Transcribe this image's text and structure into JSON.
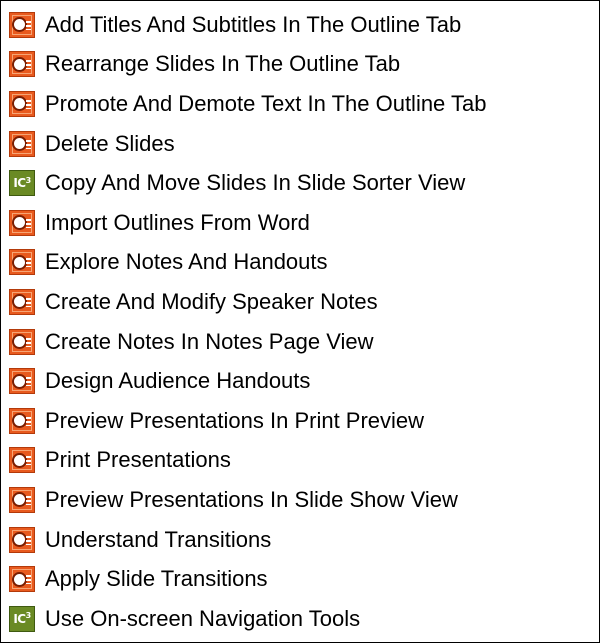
{
  "items": [
    {
      "label": "Add Titles And Subtitles In The Outline Tab",
      "icon": "ppt"
    },
    {
      "label": "Rearrange Slides In The Outline Tab",
      "icon": "ppt"
    },
    {
      "label": "Promote And Demote Text In The Outline Tab",
      "icon": "ppt"
    },
    {
      "label": "Delete Slides",
      "icon": "ppt"
    },
    {
      "label": "Copy And Move Slides In Slide Sorter View",
      "icon": "ic3",
      "badge": "IC",
      "badge_sup": "3"
    },
    {
      "label": "Import Outlines From Word",
      "icon": "ppt"
    },
    {
      "label": "Explore Notes And Handouts",
      "icon": "ppt"
    },
    {
      "label": "Create And Modify Speaker Notes",
      "icon": "ppt"
    },
    {
      "label": "Create Notes In Notes Page View",
      "icon": "ppt"
    },
    {
      "label": "Design Audience Handouts",
      "icon": "ppt"
    },
    {
      "label": "Preview Presentations In Print Preview",
      "icon": "ppt"
    },
    {
      "label": "Print Presentations",
      "icon": "ppt"
    },
    {
      "label": "Preview Presentations In Slide Show View",
      "icon": "ppt"
    },
    {
      "label": "Understand Transitions",
      "icon": "ppt"
    },
    {
      "label": "Apply Slide Transitions",
      "icon": "ppt"
    },
    {
      "label": "Use On-screen Navigation Tools",
      "icon": "ic3",
      "badge": "IC",
      "badge_sup": "3"
    }
  ],
  "colors": {
    "ppt_icon": "#e85a1e",
    "ic3_icon": "#6a8a24",
    "border": "#000000"
  }
}
